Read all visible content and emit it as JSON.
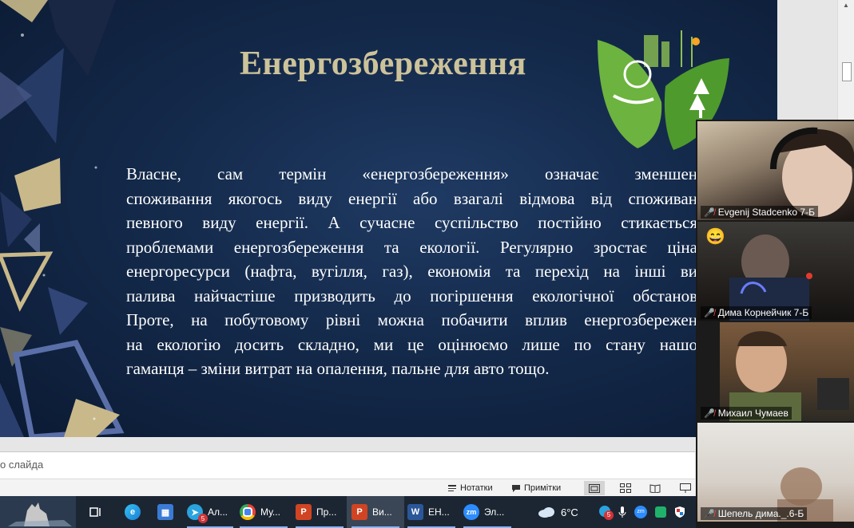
{
  "slide": {
    "title": "Енергозбереження",
    "body_lines": [
      "Власне, сам термін «енергозбереження» означає зменшен",
      "споживання якогось виду енергії або взагалі відмова від споживан",
      "певного виду енергії. А сучасне суспільство постійно стикається",
      "проблемами енергозбереження та екології. Регулярно зростає ціна",
      "енергоресурси (нафта, вугілля, газ), економія та перехід на інші ви",
      "палива найчастіше призводить до погіршення екологічної обстанов",
      "Проте, на побутовому рівні можна побачити вплив енергозбережен",
      "на екологію досить складно, ми це оцінюємо лише по стану нашо",
      "гаманця – зміни витрат на опалення, пальне для авто тощо."
    ]
  },
  "notes": {
    "placeholder": "о слайда"
  },
  "statusbar": {
    "notes_label": "Нотатки",
    "comments_label": "Примітки"
  },
  "taskbar": {
    "apps": [
      {
        "label": "Ал...",
        "icon": "telegram-icon",
        "badge": "5"
      },
      {
        "label": "Му...",
        "icon": "chrome-icon"
      },
      {
        "label": "Пр...",
        "icon": "powerpoint-icon"
      },
      {
        "label": "Ви...",
        "icon": "powerpoint-icon",
        "active": true
      },
      {
        "label": "ЕН...",
        "icon": "word-icon"
      },
      {
        "label": "Эл...",
        "icon": "zoom-icon"
      }
    ],
    "weather": "6°C",
    "tray_badge": "5"
  },
  "zoom": {
    "participants": [
      {
        "name": "Evgenij Stadcenko 7-Б"
      },
      {
        "name": "Дима Корнейчик 7-Б",
        "emoji": "😄"
      },
      {
        "name": "Михаил Чумаев"
      },
      {
        "name": "Шепель дима._.6-Б"
      }
    ]
  },
  "colors": {
    "slide_bg": "#142a4b",
    "title": "#cdc39a",
    "eco_green": "#6db33f",
    "taskbar": "#1c2633",
    "muted_mic": "#ff4848"
  }
}
